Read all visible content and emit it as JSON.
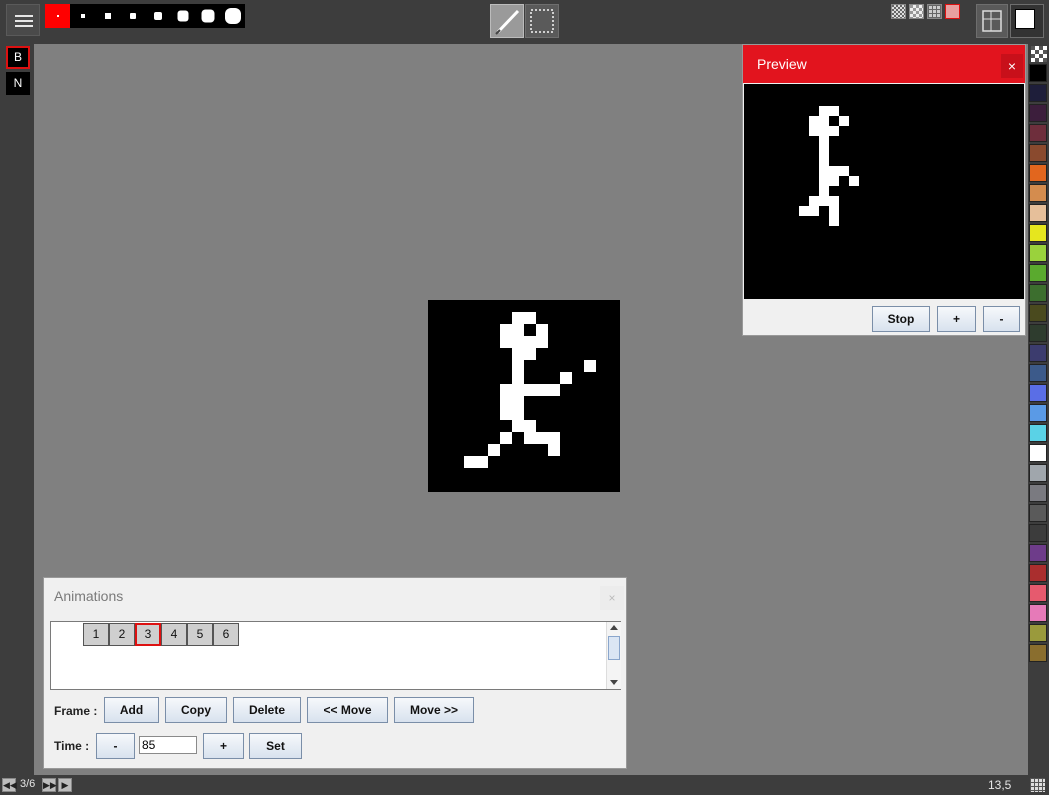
{
  "toolbar": {
    "menu_icon": "hamburger-icon",
    "brush_sizes": [
      {
        "name": "brush-size-1",
        "selected": true
      },
      {
        "name": "brush-size-2",
        "selected": false
      },
      {
        "name": "brush-size-3",
        "selected": false
      },
      {
        "name": "brush-size-4",
        "selected": false
      },
      {
        "name": "brush-size-5",
        "selected": false
      },
      {
        "name": "brush-size-6",
        "selected": false
      },
      {
        "name": "brush-size-7",
        "selected": false
      },
      {
        "name": "brush-size-8",
        "selected": false
      }
    ],
    "tools": [
      {
        "name": "pencil-tool",
        "icon": "pencil-icon",
        "selected": true
      },
      {
        "name": "select-tool",
        "icon": "dashed-rectangle-icon",
        "selected": false
      }
    ],
    "patterns": [
      "checker-pattern-icon",
      "checker-pattern-icon",
      "grid-pattern-icon",
      "red-square-icon"
    ],
    "grid_toggle_icon": "grid-overlay-icon",
    "current_color": "#ffffff"
  },
  "layers": {
    "items": [
      {
        "label": "B",
        "selected": true
      },
      {
        "label": "N",
        "selected": false
      }
    ]
  },
  "palette": {
    "colors": [
      "#000000",
      "#1e1e3a",
      "#3c1e3c",
      "#6e2e3c",
      "#8a4a2e",
      "#e2661e",
      "#d48c4e",
      "#e6bf9a",
      "#e6e61e",
      "#9ad23c",
      "#5aaa2e",
      "#3c6e2e",
      "#4a4a1e",
      "#2e3c2e",
      "#3c3c6e",
      "#3c5a8a",
      "#5a6ee6",
      "#5a9ae6",
      "#5ad2e6",
      "#ffffff",
      "#a0a6ac",
      "#7a7a80",
      "#5a5a5a",
      "#3c3c3c",
      "#6e3c8a",
      "#aa2e2e",
      "#e65a6e",
      "#e67ab8",
      "#9a9a3c",
      "#8a6e2e"
    ]
  },
  "preview": {
    "title": "Preview",
    "close_label": "×",
    "stop_label": "Stop",
    "plus_label": "+",
    "minus_label": "-"
  },
  "animations": {
    "title": "Animations",
    "close_label": "×",
    "frames": [
      "1",
      "2",
      "3",
      "4",
      "5",
      "6"
    ],
    "selected_frame": "3",
    "frame_label": "Frame :",
    "add_label": "Add",
    "copy_label": "Copy",
    "delete_label": "Delete",
    "move_left_label": "<< Move",
    "move_right_label": "Move >>",
    "time_label": "Time :",
    "time_minus_label": "-",
    "time_value": "85",
    "time_plus_label": "+",
    "set_label": "Set"
  },
  "status": {
    "frame_counter": "3/6",
    "first_icon": "rewind-icon",
    "last_icon": "fast-forward-icon",
    "play_icon": "play-icon",
    "coords": "13,5",
    "grid_icon": "grid-icon"
  }
}
